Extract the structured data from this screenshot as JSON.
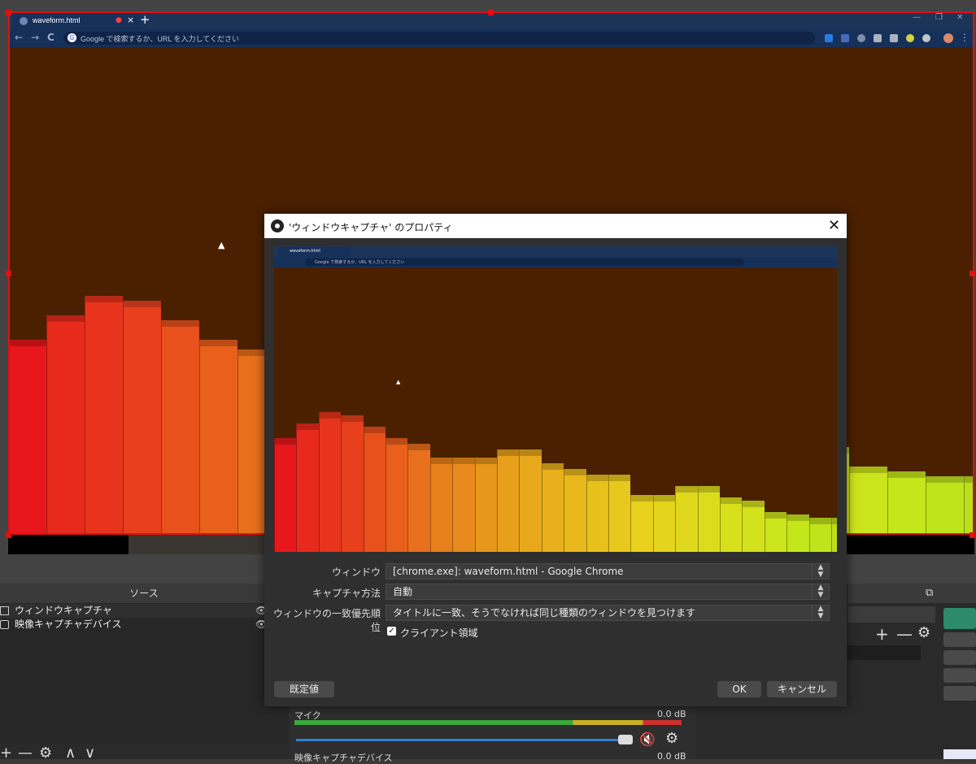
{
  "chrome": {
    "tab_title": "waveform.html",
    "omnibox_placeholder": "Google で検索するか、URL を入力してください",
    "new_tab": "+",
    "close_tab": "×",
    "back": "←",
    "forward": "→",
    "reload": "C",
    "google_g": "G",
    "minimize": "—",
    "restore": "❐",
    "close": "✕"
  },
  "chart_data": {
    "type": "bar",
    "series_main_heights": [
      0.4,
      0.45,
      0.49,
      0.48,
      0.44,
      0.4,
      0.38,
      0.33,
      0.33,
      0.33,
      0.36,
      0.36,
      0.31,
      0.29,
      0.27,
      0.27,
      0.2,
      0.2,
      0.23,
      0.23,
      0.19,
      0.18,
      0.14,
      0.13,
      0.12,
      0.12,
      0.23,
      0.21,
      0.24,
      0.24
    ],
    "colors": [
      "#e8171c",
      "#e82a1c",
      "#e8341c",
      "#e8401c",
      "#e8501c",
      "#e8601c",
      "#e8701c",
      "#e8801c",
      "#e88a1c",
      "#e8961c",
      "#e8a01c",
      "#e8a81c",
      "#e8b01c",
      "#e8b81c",
      "#e8c01c",
      "#e8c81c",
      "#e8d01c",
      "#e4d41c",
      "#e0d81c",
      "#dcdc1c",
      "#d8e01c",
      "#d2e21c",
      "#cce41c",
      "#c6e61c",
      "#c0e41c",
      "#bcde1c",
      "#c4e21c",
      "#cae41c",
      "#cce41c",
      "#cce41c"
    ]
  },
  "dialog": {
    "title": "'ウィンドウキャプチャ' のプロパティ",
    "close": "✕",
    "fields": [
      {
        "label": "ウィンドウ",
        "value": "[chrome.exe]: waveform.html - Google Chrome"
      },
      {
        "label": "キャプチャ方法",
        "value": "自動"
      },
      {
        "label": "ウィンドウの一致優先順位",
        "value": "タイトルに一致、そうでなければ同じ種類のウィンドウを見つけます"
      }
    ],
    "checkbox_label": "クライアント領域",
    "checkbox_mark": "✓",
    "defaults_button": "既定値",
    "ok_button": "OK",
    "cancel_button": "キャンセル",
    "spin_up": "▲",
    "spin_down": "▼"
  },
  "sources": {
    "title": "ソース",
    "items": [
      {
        "label": "ウィンドウキャプチャ"
      },
      {
        "label": "映像キャプチャデバイス"
      }
    ],
    "eye": "👁",
    "add": "+",
    "remove": "—",
    "settings": "⚙",
    "up": "∧",
    "down": "∨"
  },
  "mixer": {
    "channel_name": "マイク",
    "db_value": "0.0 dB",
    "mute_icon": "🔇",
    "gear": "⚙",
    "next_channel": "映像キャプチャデバイス",
    "next_db": "0.0 dB",
    "volume_fraction": 0.98
  },
  "right_dock": {
    "add": "+",
    "remove": "—",
    "settings": "⚙",
    "float": "⧉"
  }
}
